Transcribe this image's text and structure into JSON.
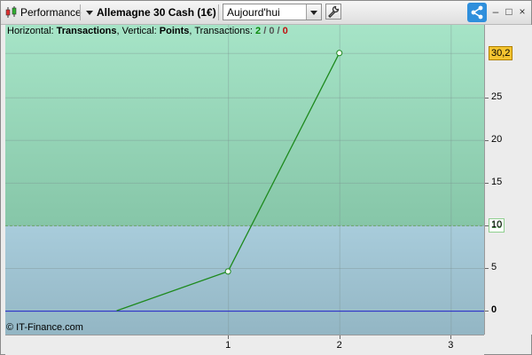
{
  "toolbar": {
    "performance_label": "Performance",
    "instrument": "Allemagne 30 Cash (1€)",
    "period": "Aujourd'hui"
  },
  "info": {
    "horizontal_prefix": "Horizontal: ",
    "horizontal_value": "Transactions",
    "vertical_prefix": ", Vertical: ",
    "vertical_value": "Points",
    "transactions_prefix": ", Transactions: ",
    "tx_win": "2",
    "tx_sep1": " / ",
    "tx_neutral": "0",
    "tx_sep2": " / ",
    "tx_loss": "0"
  },
  "copyright": "© IT-Finance.com",
  "colors": {
    "line": "#1e8a1e",
    "zero_line": "#2020c8",
    "zone_top": "#9edcbf",
    "zone_bottom": "#a4c7d6",
    "badge_last": "#f4c430",
    "share_button": "#2f8fdc"
  },
  "icons": [
    "candlestick-icon",
    "wrench-icon",
    "share-icon",
    "minimize-icon",
    "maximize-icon",
    "close-icon"
  ],
  "chart_data": {
    "type": "line",
    "x": [
      0,
      1,
      2
    ],
    "y": [
      0,
      4.6,
      30.2
    ],
    "xlim": [
      -1,
      3.3
    ],
    "ylim": [
      -2.8,
      33.5
    ],
    "x_ticks": [
      "1",
      "2",
      "3"
    ],
    "x_tick_values": [
      1,
      2,
      3
    ],
    "y_ticks": [
      "0",
      "5",
      "10",
      "15",
      "20",
      "25"
    ],
    "y_tick_values": [
      0,
      5,
      10,
      15,
      20,
      25
    ],
    "last_value_label": "30,2",
    "last_value": 30.2,
    "threshold_label": "10",
    "threshold_value": 10,
    "grid": true
  }
}
